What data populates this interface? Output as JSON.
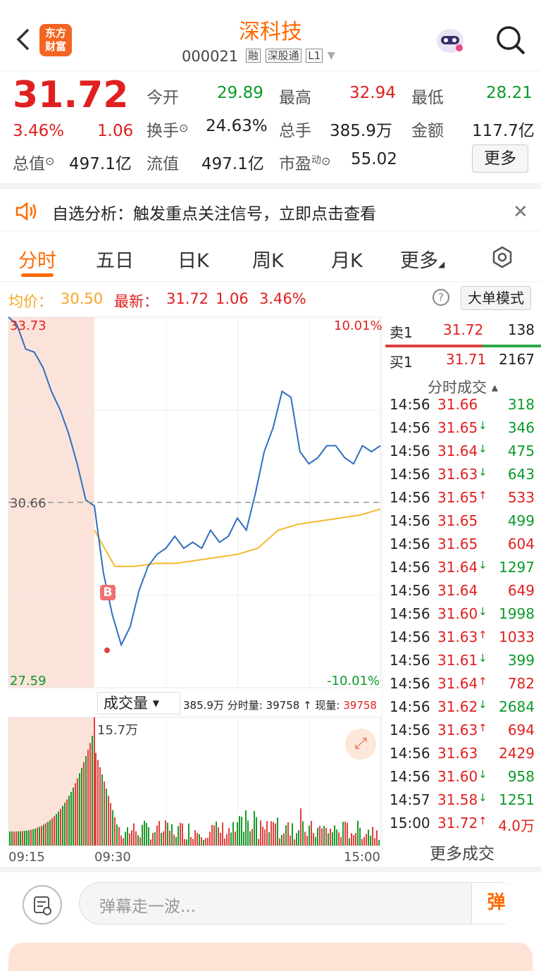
{
  "header": {
    "title": "深科技",
    "code": "000021",
    "badges": [
      "融",
      "深股通",
      "L1"
    ],
    "logo_text": "东方财富"
  },
  "quote": {
    "price": "31.72",
    "change_pct": "3.46%",
    "change": "1.06",
    "open_label": "今开",
    "open": "29.89",
    "high_label": "最高",
    "high": "32.94",
    "low_label": "最低",
    "low": "28.21",
    "turnover_label": "换手",
    "turnover": "24.63%",
    "volume_label": "总手",
    "volume": "385.9万",
    "amount_label": "金额",
    "amount": "117.7亿",
    "mktcap_label": "总值",
    "mktcap": "497.1亿",
    "float_label": "流值",
    "float": "497.1亿",
    "pe_label": "市盈",
    "pe_sup": "动",
    "pe": "55.02",
    "more_button": "更多"
  },
  "ad": {
    "text": "自选分析：触发重点关注信号，立即点击查看"
  },
  "tabs": [
    "分时",
    "五日",
    "日K",
    "周K",
    "月K",
    "更多"
  ],
  "infobar": {
    "avg_label": "均价：",
    "avg": "30.50",
    "latest_label": "最新：",
    "latest": "31.72",
    "latest_chg": "1.06",
    "latest_pct": "3.46%",
    "mode_button": "大单模式"
  },
  "chart_labels": {
    "y_top": "33.73",
    "y_mid": "30.66",
    "y_bottom": "27.59",
    "pct_top": "10.01%",
    "pct_bottom": "-10.01%",
    "vol_dropdown": "成交量",
    "vol_info_total": "385.9万",
    "vol_info_minute_label": "分时量:",
    "vol_info_minute": "39758",
    "vol_info_now_label": "现量:",
    "vol_info_now": "39758",
    "vol_max": "15.7万",
    "x_start": "09:15",
    "x_open": "09:30",
    "x_end": "15:00",
    "buy_marker": "B"
  },
  "chart_data": {
    "type": "line",
    "xlabel": "",
    "ylabel": "",
    "x": [
      "09:15",
      "09:30",
      "15:00"
    ],
    "ylim": [
      27.59,
      33.73
    ],
    "prev_close": 30.66,
    "series": [
      {
        "values": [
          33.73,
          33.6,
          33.2,
          33.15,
          32.9,
          32.5,
          32.2,
          31.8,
          31.3,
          30.7,
          30.6,
          29.5,
          28.8,
          28.3,
          28.6,
          29.2,
          29.6,
          29.8,
          29.9,
          30.1,
          29.9,
          30.0,
          29.9,
          30.2,
          30.0,
          30.1,
          30.4,
          30.2,
          30.8,
          31.5,
          31.9,
          32.5,
          32.4,
          31.5,
          31.3,
          31.4,
          31.6,
          31.6,
          31.4,
          31.3,
          31.6,
          31.5,
          31.6
        ]
      },
      {
        "values": [
          30.2,
          29.6,
          29.6,
          29.65,
          29.65,
          29.7,
          29.75,
          29.8,
          29.9,
          30.2,
          30.3,
          30.35,
          30.4,
          30.45,
          30.55
        ]
      }
    ]
  },
  "trades": {
    "ask_label": "卖1",
    "ask_price": "31.72",
    "ask_vol": "138",
    "bid_label": "买1",
    "bid_price": "31.71",
    "bid_vol": "2167",
    "title": "分时成交",
    "rows": [
      {
        "t": "14:56",
        "p": "31.66",
        "d": "",
        "v": "318",
        "c": "green"
      },
      {
        "t": "14:56",
        "p": "31.65",
        "d": "↓",
        "v": "346",
        "c": "green"
      },
      {
        "t": "14:56",
        "p": "31.64",
        "d": "↓",
        "v": "475",
        "c": "green"
      },
      {
        "t": "14:56",
        "p": "31.63",
        "d": "↓",
        "v": "643",
        "c": "green"
      },
      {
        "t": "14:56",
        "p": "31.65",
        "d": "↑",
        "v": "533",
        "c": "red"
      },
      {
        "t": "14:56",
        "p": "31.65",
        "d": "",
        "v": "499",
        "c": "green"
      },
      {
        "t": "14:56",
        "p": "31.65",
        "d": "",
        "v": "604",
        "c": "red"
      },
      {
        "t": "14:56",
        "p": "31.64",
        "d": "↓",
        "v": "1297",
        "c": "green"
      },
      {
        "t": "14:56",
        "p": "31.64",
        "d": "",
        "v": "649",
        "c": "red"
      },
      {
        "t": "14:56",
        "p": "31.60",
        "d": "↓",
        "v": "1998",
        "c": "green"
      },
      {
        "t": "14:56",
        "p": "31.63",
        "d": "↑",
        "v": "1033",
        "c": "red"
      },
      {
        "t": "14:56",
        "p": "31.61",
        "d": "↓",
        "v": "399",
        "c": "green"
      },
      {
        "t": "14:56",
        "p": "31.64",
        "d": "↑",
        "v": "782",
        "c": "red"
      },
      {
        "t": "14:56",
        "p": "31.62",
        "d": "↓",
        "v": "2684",
        "c": "green"
      },
      {
        "t": "14:56",
        "p": "31.63",
        "d": "↑",
        "v": "694",
        "c": "red"
      },
      {
        "t": "14:56",
        "p": "31.63",
        "d": "",
        "v": "2429",
        "c": "red"
      },
      {
        "t": "14:56",
        "p": "31.60",
        "d": "↓",
        "v": "958",
        "c": "green"
      },
      {
        "t": "14:57",
        "p": "31.58",
        "d": "↓",
        "v": "1251",
        "c": "green"
      },
      {
        "t": "15:00",
        "p": "31.72",
        "d": "↑",
        "v": "4.0万",
        "c": "red"
      }
    ],
    "more": "更多成交"
  },
  "bottom": {
    "placeholder": "弹幕走一波...",
    "danmu_button": "弹"
  },
  "colors": {
    "accent": "#ff6a00",
    "up": "#e02020",
    "down": "#0a9a2a",
    "price_line": "#2f6fc0",
    "avg_line": "#f5b82e"
  }
}
